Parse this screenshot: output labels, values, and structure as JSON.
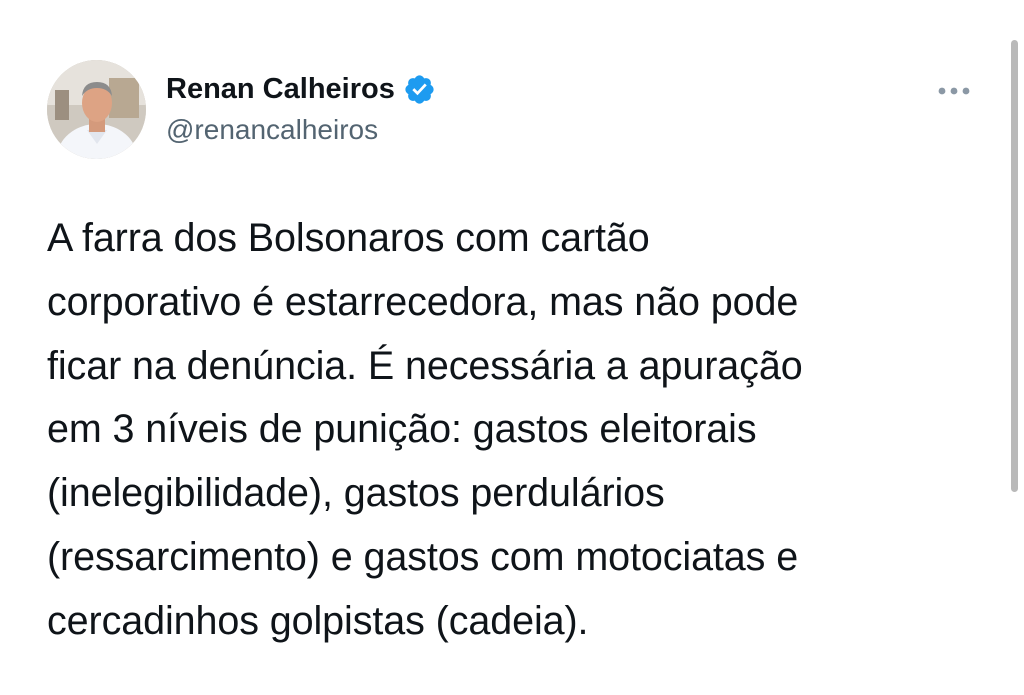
{
  "tweet": {
    "author": {
      "display_name": "Renan Calheiros",
      "handle": "@renancalheiros",
      "verified": true,
      "avatar_icon": "user-photo"
    },
    "more_icon": "more-horizontal-icon",
    "text": "A farra dos Bolsonaros com cartão\ncorporativo é estarrecedora, mas não pode\nficar na denúncia. É necessária a apuração\nem 3 níveis de punição: gastos eleitorais\n(inelegibilidade), gastos perdulários\n(ressarcimento) e gastos com motociatas e\ncercadinhos golpistas (cadeia)."
  },
  "colors": {
    "text": "#0f1419",
    "secondary": "#536471",
    "verified": "#1d9bf0",
    "scrollbar": "#b9b9b9"
  }
}
